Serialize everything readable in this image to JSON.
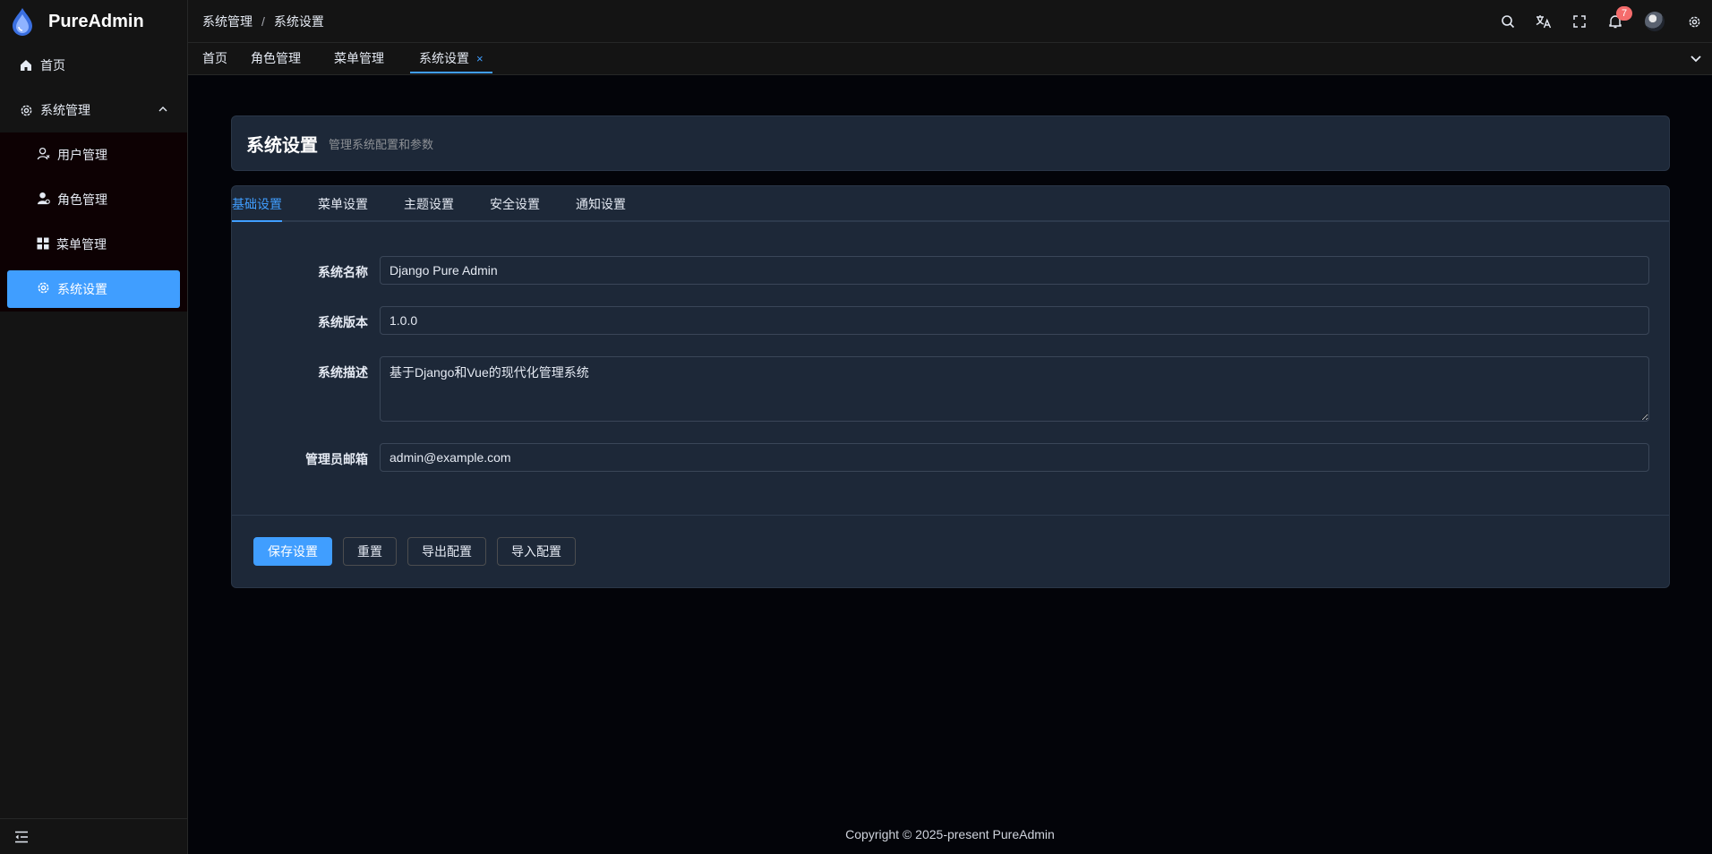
{
  "app": {
    "name": "PureAdmin"
  },
  "sidebar": {
    "home": "首页",
    "group": "系统管理",
    "items": [
      {
        "label": "用户管理",
        "icon": "user-icon"
      },
      {
        "label": "角色管理",
        "icon": "role-icon"
      },
      {
        "label": "菜单管理",
        "icon": "grid-icon"
      },
      {
        "label": "系统设置",
        "icon": "gear-icon",
        "active": true
      }
    ]
  },
  "header": {
    "breadcrumb": [
      "系统管理",
      "系统设置"
    ],
    "breadcrumb_sep": "/",
    "notification_count": "7"
  },
  "tabs": [
    {
      "label": "首页"
    },
    {
      "label": "角色管理"
    },
    {
      "label": "菜单管理"
    },
    {
      "label": "系统设置",
      "active": true,
      "close": "×"
    }
  ],
  "page": {
    "title": "系统设置",
    "subtitle": "管理系统配置和参数"
  },
  "settings_tabs": [
    {
      "label": "基础设置",
      "active": true
    },
    {
      "label": "菜单设置"
    },
    {
      "label": "主题设置"
    },
    {
      "label": "安全设置"
    },
    {
      "label": "通知设置"
    }
  ],
  "form": {
    "fields": [
      {
        "label": "系统名称",
        "value": "Django Pure Admin"
      },
      {
        "label": "系统版本",
        "value": "1.0.0"
      },
      {
        "label": "系统描述",
        "value": "基于Django和Vue的现代化管理系统"
      },
      {
        "label": "管理员邮箱",
        "value": "admin@example.com"
      }
    ]
  },
  "buttons": {
    "save": "保存设置",
    "reset": "重置",
    "export": "导出配置",
    "import": "导入配置"
  },
  "footer": {
    "copyright": "Copyright © 2025-present PureAdmin"
  },
  "colors": {
    "accent": "#409eff",
    "badge": "#f56c6c",
    "card": "#1d2838",
    "bg": "#030409"
  }
}
